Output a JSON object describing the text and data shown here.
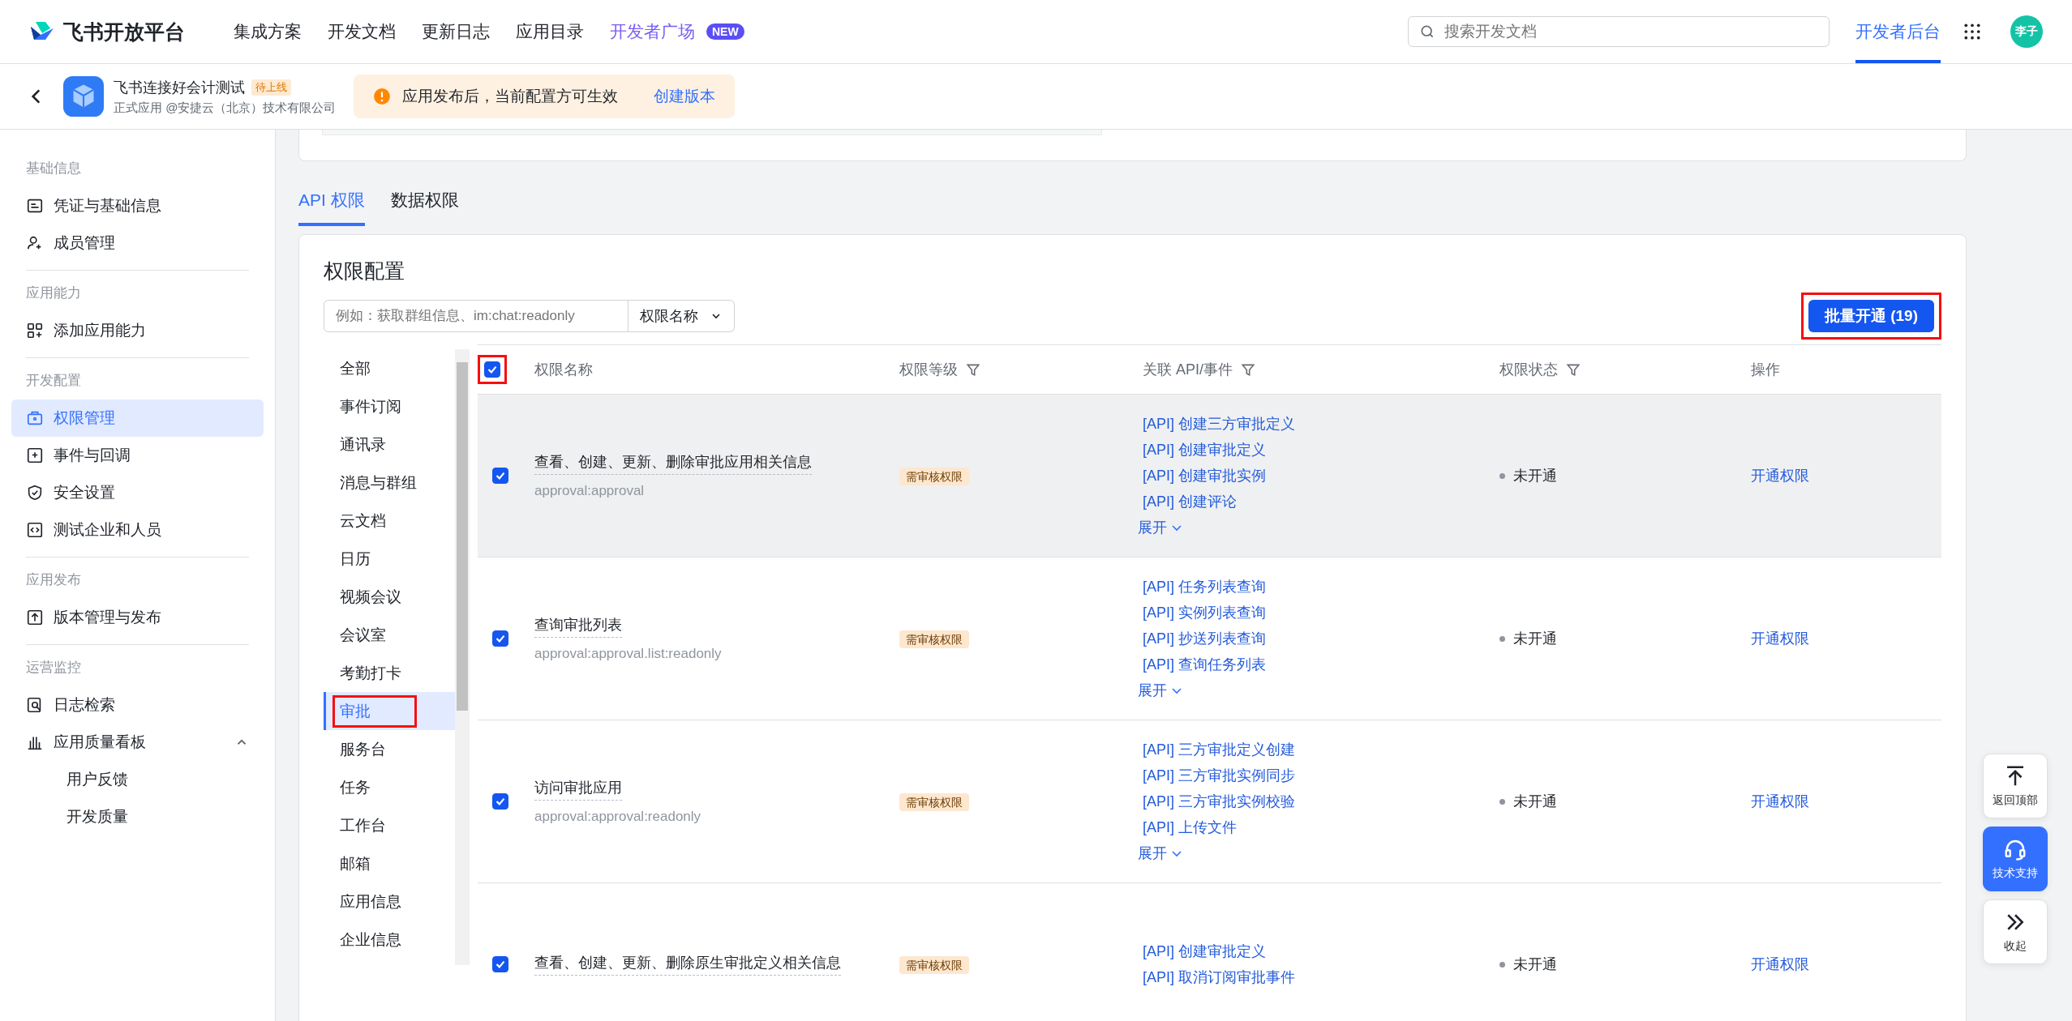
{
  "header": {
    "logo": "飞书开放平台",
    "nav": [
      {
        "label": "集成方案"
      },
      {
        "label": "开发文档"
      },
      {
        "label": "更新日志"
      },
      {
        "label": "应用目录"
      },
      {
        "label": "开发者广场",
        "badge": "NEW"
      }
    ],
    "search": {
      "placeholder": "搜索开发文档"
    },
    "console_tab": {
      "label": "开发者后台",
      "selected": true
    },
    "avatar": "李子"
  },
  "app_bar": {
    "name": "飞书连接好会计测试",
    "status": "待上线",
    "subtitle": "正式应用 @安捷云（北京）技术有限公司",
    "notice": "应用发布后，当前配置方可生效",
    "notice_action": "创建版本"
  },
  "sidebar": {
    "sections": [
      {
        "title": "基础信息",
        "items": [
          {
            "label": "凭证与基础信息",
            "selected": false
          },
          {
            "label": "成员管理",
            "selected": false
          }
        ]
      },
      {
        "title": "应用能力",
        "items": [
          {
            "label": "添加应用能力",
            "selected": false
          }
        ]
      },
      {
        "title": "开发配置",
        "items": [
          {
            "label": "权限管理",
            "selected": true
          },
          {
            "label": "事件与回调",
            "selected": false
          },
          {
            "label": "安全设置",
            "selected": false
          },
          {
            "label": "测试企业和人员",
            "selected": false
          }
        ]
      },
      {
        "title": "应用发布",
        "items": [
          {
            "label": "版本管理与发布",
            "selected": false
          }
        ]
      },
      {
        "title": "运营监控",
        "items": [
          {
            "label": "日志检索",
            "selected": false
          },
          {
            "label": "应用质量看板",
            "selected": false,
            "expanded": true,
            "children": [
              {
                "label": "用户反馈",
                "selected": false
              },
              {
                "label": "开发质量",
                "selected": false
              }
            ]
          }
        ]
      }
    ]
  },
  "tabs": [
    {
      "label": "API 权限",
      "selected": true
    },
    {
      "label": "数据权限",
      "selected": false
    }
  ],
  "card": {
    "title": "权限配置",
    "search": {
      "placeholder": "例如：获取群组信息、im:chat:readonly"
    },
    "filter_select": "权限名称",
    "batch_button": {
      "label": "批量开通 (19)",
      "highlighted": true
    }
  },
  "categories": [
    {
      "label": "全部",
      "selected": false,
      "highlighted": false
    },
    {
      "label": "事件订阅",
      "selected": false,
      "highlighted": false
    },
    {
      "label": "通讯录",
      "selected": false,
      "highlighted": false
    },
    {
      "label": "消息与群组",
      "selected": false,
      "highlighted": false
    },
    {
      "label": "云文档",
      "selected": false,
      "highlighted": false
    },
    {
      "label": "日历",
      "selected": false,
      "highlighted": false
    },
    {
      "label": "视频会议",
      "selected": false,
      "highlighted": false
    },
    {
      "label": "会议室",
      "selected": false,
      "highlighted": false
    },
    {
      "label": "考勤打卡",
      "selected": false,
      "highlighted": false
    },
    {
      "label": "审批",
      "selected": true,
      "highlighted": true
    },
    {
      "label": "服务台",
      "selected": false,
      "highlighted": false
    },
    {
      "label": "任务",
      "selected": false,
      "highlighted": false
    },
    {
      "label": "工作台",
      "selected": false,
      "highlighted": false
    },
    {
      "label": "邮箱",
      "selected": false,
      "highlighted": false
    },
    {
      "label": "应用信息",
      "selected": false,
      "highlighted": false
    },
    {
      "label": "企业信息",
      "selected": false,
      "highlighted": false
    }
  ],
  "table": {
    "select_all": {
      "checked": true,
      "highlighted": true
    },
    "columns": [
      {
        "label": "权限名称",
        "filter": false
      },
      {
        "label": "权限等级",
        "filter": true
      },
      {
        "label": "关联 API/事件",
        "filter": true
      },
      {
        "label": "权限状态",
        "filter": true
      },
      {
        "label": "操作",
        "filter": false
      }
    ],
    "rows": [
      {
        "checked": true,
        "hovered": true,
        "name": "查看、创建、更新、删除审批应用相关信息",
        "scope": "approval:approval",
        "level": "需审核权限",
        "apis": [
          "[API] 创建三方审批定义",
          "[API] 创建审批定义",
          "[API] 创建审批实例",
          "[API] 创建评论"
        ],
        "expand": "展开",
        "status": "未开通",
        "action": "开通权限"
      },
      {
        "checked": true,
        "hovered": false,
        "name": "查询审批列表",
        "scope": "approval:approval.list:readonly",
        "level": "需审核权限",
        "apis": [
          "[API] 任务列表查询",
          "[API] 实例列表查询",
          "[API] 抄送列表查询",
          "[API] 查询任务列表"
        ],
        "expand": "展开",
        "status": "未开通",
        "action": "开通权限"
      },
      {
        "checked": true,
        "hovered": false,
        "name": "访问审批应用",
        "scope": "approval:approval:readonly",
        "level": "需审核权限",
        "apis": [
          "[API] 三方审批定义创建",
          "[API] 三方审批实例同步",
          "[API] 三方审批实例校验",
          "[API] 上传文件"
        ],
        "expand": "展开",
        "status": "未开通",
        "action": "开通权限"
      },
      {
        "checked": true,
        "hovered": false,
        "name": "查看、创建、更新、删除原生审批定义相关信息",
        "level": "需审核权限",
        "apis": [
          "[API] 创建审批定义",
          "[API] 取消订阅审批事件"
        ],
        "status": "未开通",
        "action": "开通权限"
      }
    ]
  },
  "float_buttons": [
    {
      "kind": "top",
      "label": "返回顶部",
      "active": false
    },
    {
      "kind": "support",
      "label": "技术支持",
      "active": true
    },
    {
      "kind": "collapse",
      "label": "收起",
      "active": false
    }
  ]
}
